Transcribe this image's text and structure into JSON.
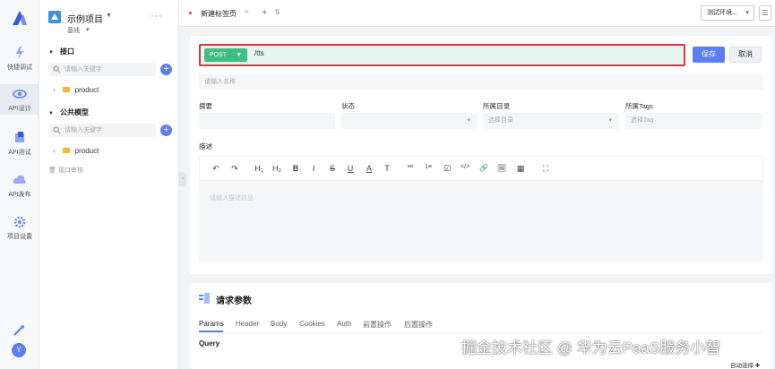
{
  "rail": {
    "items": [
      {
        "label": "快捷调试",
        "icon": "lightning-icon"
      },
      {
        "label": "API设计",
        "icon": "api-design-icon",
        "active": true
      },
      {
        "label": "API测试",
        "icon": "api-test-icon"
      },
      {
        "label": "API发布",
        "icon": "cloud-publish-icon"
      },
      {
        "label": "项目设置",
        "icon": "gear-icon"
      }
    ],
    "avatar_letter": "Y",
    "accent": "#5b7ef0"
  },
  "sidebar": {
    "project_name": "示例项目",
    "branch": "基线",
    "more": "···",
    "api_section": {
      "title": "接口",
      "search_placeholder": "请输入关键字",
      "items": [
        "product"
      ]
    },
    "model_section": {
      "title": "公共模型",
      "search_placeholder": "请输入关键字",
      "items": [
        "product"
      ]
    },
    "recycle_bin": "接口审核"
  },
  "tabs": {
    "items": [
      {
        "label": "新建标签页",
        "close": "✕"
      }
    ],
    "add": "+",
    "env_select": "测试环境...",
    "env_icon": "☰"
  },
  "request": {
    "method": "POST",
    "url": "/tts",
    "save_label": "保存",
    "cancel_label": "取消",
    "name_placeholder": "请输入名称",
    "fields": {
      "summary": {
        "label": "摘要",
        "value": ""
      },
      "status": {
        "label": "状态",
        "value": ""
      },
      "directory": {
        "label": "所属目录",
        "placeholder": "选择目录"
      },
      "tags": {
        "label": "所属Tags",
        "placeholder": "选择Tag"
      }
    },
    "description": {
      "label": "描述",
      "placeholder": "请输入描述信息",
      "toolbar": [
        "↶",
        "↷",
        "H₁",
        "H₂",
        "B",
        "I",
        "S",
        "U",
        "A",
        "T",
        "•≡",
        "1≡",
        "☑",
        "</>",
        "🔗",
        "🖼",
        "▦",
        "⛶"
      ]
    },
    "colors": {
      "method": "#3fbf81",
      "url_bg": "#e6f5ef",
      "highlight": "#d9363e",
      "primary": "#5b7ef0"
    }
  },
  "params": {
    "title": "请求参数",
    "tabs": [
      "Params",
      "Header",
      "Body",
      "Cookies",
      "Auth",
      "前置操作",
      "后置操作"
    ],
    "active_tab": "Params",
    "query_label": "Query"
  },
  "footer": {
    "watermark": "掘金技术社区 @ 华为云PaaS服务小智",
    "auto_select": "自动选择 ✚"
  }
}
